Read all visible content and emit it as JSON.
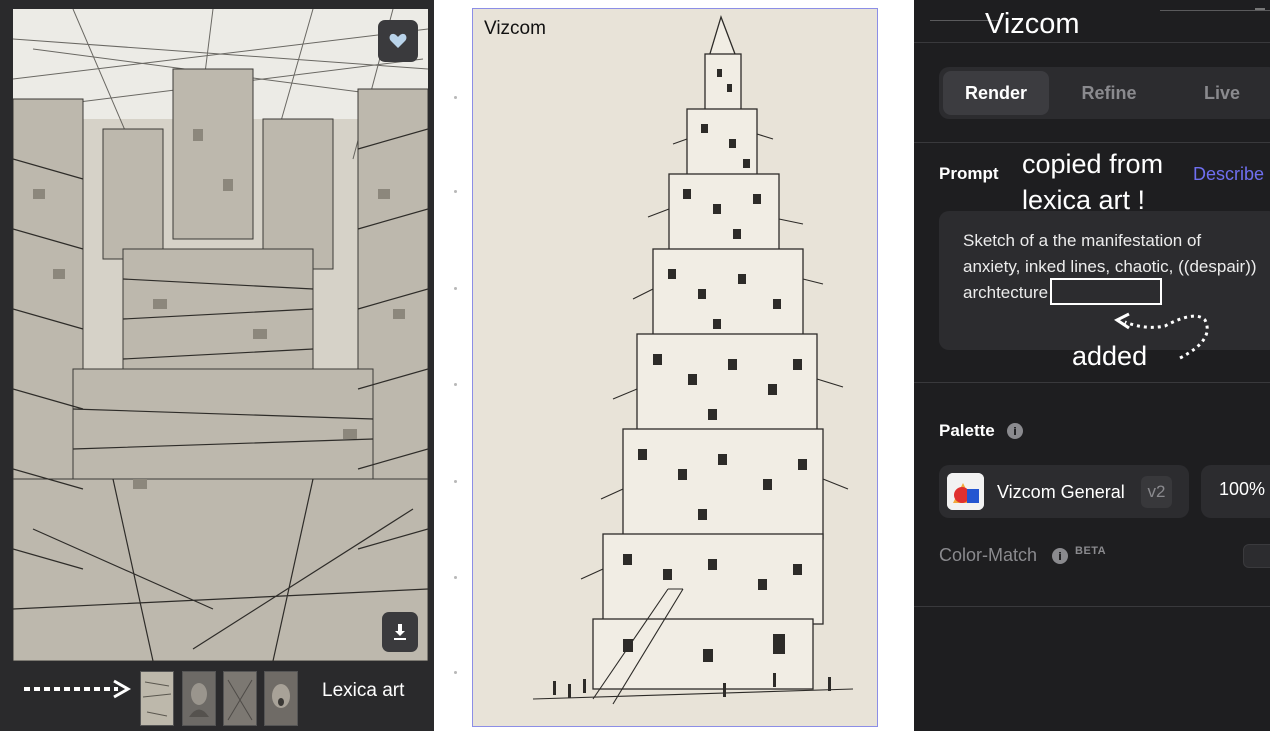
{
  "lexica": {
    "label": "Lexica art",
    "favorite_icon": "heart-icon",
    "download_icon": "download-icon",
    "thumbnails_count_label": "",
    "arrow": "dotted-arrow-right"
  },
  "canvas": {
    "title": "Vizcom"
  },
  "vizcom": {
    "title": "Vizcom",
    "tabs": [
      {
        "label": "Render",
        "active": true
      },
      {
        "label": "Refine",
        "active": false
      },
      {
        "label": "Live",
        "active": false
      }
    ],
    "prompt": {
      "label": "Prompt",
      "describe_label": "Describe",
      "text": "Sketch of a the manifestation of anxiety, inked lines, chaotic, ((despair)) archtecture"
    },
    "palette": {
      "label": "Palette",
      "name": "Vizcom General",
      "version": "v2",
      "strength": "100%"
    },
    "color_match": {
      "label": "Color-Match",
      "badge": "BETA"
    }
  },
  "annotations": {
    "copied": "copied from\nlexica art !",
    "added": "added"
  },
  "colors": {
    "panel_bg": "#1e1e20",
    "card_bg": "#2c2c2f",
    "accent_link": "#6f6ff0",
    "frame_border": "#8c8ee6"
  }
}
